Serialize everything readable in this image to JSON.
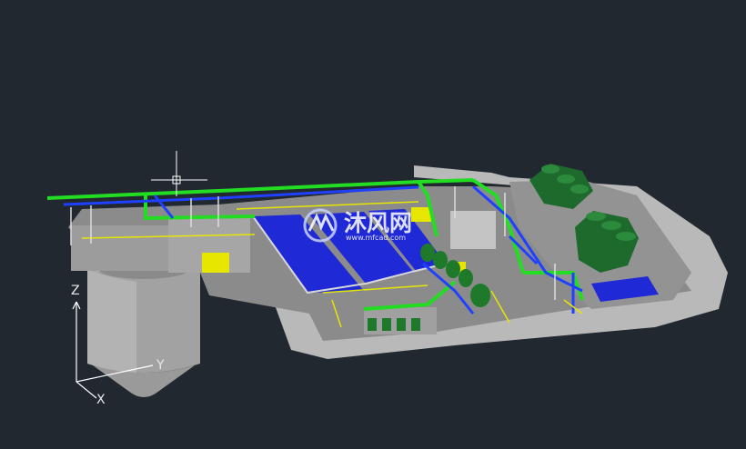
{
  "viewport": {
    "background": "#212830",
    "axes": {
      "z_label": "Z",
      "y_label": "Y",
      "x_label": "X"
    }
  },
  "watermark": {
    "text_cn": "沐风网",
    "url": "www.mfcad.com"
  },
  "colors": {
    "ground": "#8e8e8e",
    "road": "#bdbdbd",
    "tank": "#a3a3a3",
    "pool": "#1f2ad6",
    "pipe_green": "#22dd22",
    "pipe_blue": "#2040ff",
    "rail_yellow": "#e6e600",
    "cooling_tower": "#1e6e2e"
  }
}
